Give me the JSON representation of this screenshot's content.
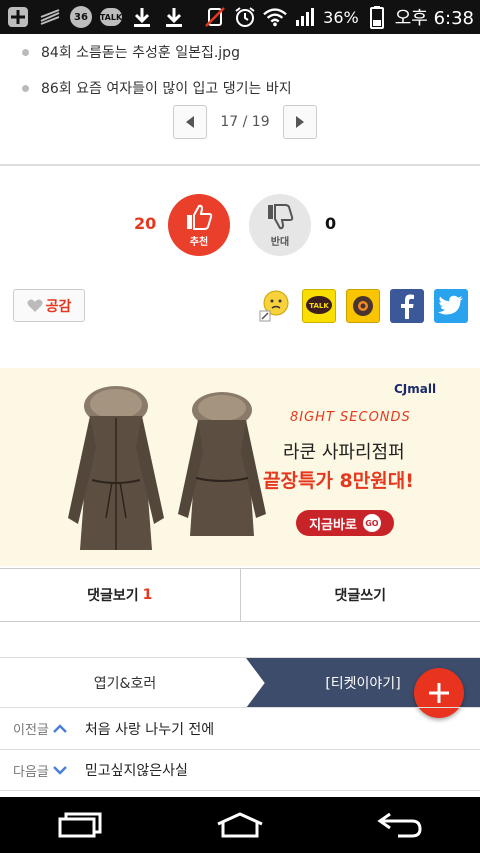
{
  "status_bar": {
    "battery": "36%",
    "time": "오후 6:38",
    "icons": [
      "plus-icon",
      "strike-icon",
      "badge-icon",
      "kakaotalk-icon",
      "download-icon",
      "download-icon",
      "mute-icon",
      "alarm-icon",
      "wifi-icon",
      "signal-icon",
      "battery-icon"
    ],
    "badge_number": "36",
    "talk_label": "TALK"
  },
  "related": {
    "items": [
      {
        "label": "84회 소름돋는 추성훈 일본집.jpg"
      },
      {
        "label": "86회 요즘 여자들이 많이 입고 댕기는 바지"
      }
    ]
  },
  "pager": {
    "text": "17 / 19"
  },
  "vote": {
    "up_count": "20",
    "up_label": "추천",
    "down_label": "반대",
    "down_count": "0"
  },
  "empathy": {
    "label": "공감"
  },
  "share": {
    "icons": [
      "emoticon-icon",
      "kakaotalk-share-icon",
      "kakaostory-share-icon",
      "facebook-share-icon",
      "twitter-share-icon"
    ],
    "talk_label": "TALK"
  },
  "ad": {
    "brand": "CJmall",
    "tag": "8IGHT SECONDS",
    "line1": "라쿤 사파리점퍼",
    "line2": "끝장특가 8만원대!",
    "button": "지금바로",
    "go": "GO"
  },
  "comments": {
    "view_label": "댓글보기",
    "view_count": "1",
    "write_label": "댓글쓰기"
  },
  "categories": {
    "left": "엽기&호러",
    "right": "[티켓이야기]"
  },
  "nav": {
    "prev_key": "이전글",
    "prev_title": "처음 사랑 나누기 전에",
    "next_key": "다음글",
    "next_title": "믿고싶지않은사실"
  },
  "colors": {
    "accent": "#e93f2b",
    "navy": "#3c4c6a",
    "ad_bg": "#fdf8e4"
  }
}
